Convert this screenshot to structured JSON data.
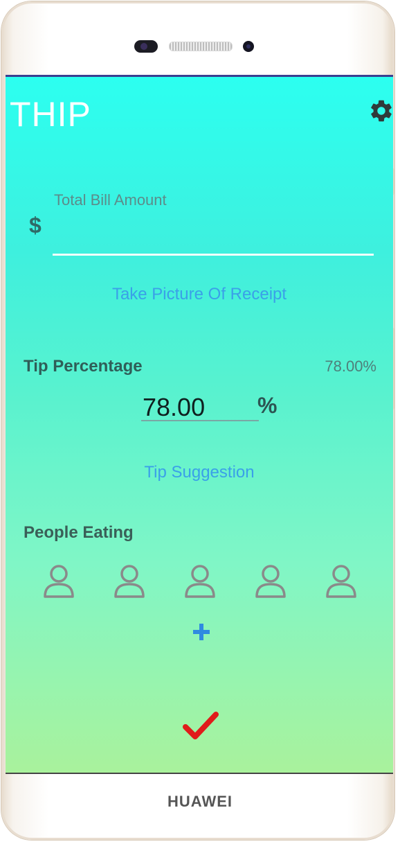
{
  "device": {
    "brand": "HUAWEI"
  },
  "app": {
    "title": "THIP",
    "settings_icon": "gear-icon"
  },
  "bill": {
    "label": "Total Bill Amount",
    "currency": "$",
    "value": "",
    "receipt_button": "Take Picture Of Receipt"
  },
  "tip": {
    "label": "Tip Percentage",
    "display_value": "78.00%",
    "input_value": "78.00",
    "unit": "%",
    "suggestion_button": "Tip Suggestion"
  },
  "people": {
    "label": "People Eating",
    "count": 5,
    "person_icon": "person-icon",
    "add_icon": "plus-icon"
  },
  "confirm": {
    "icon": "checkmark-icon"
  },
  "colors": {
    "accent_blue": "#3aa0e8",
    "confirm_red": "#e01b1b",
    "gradient_top": "#2cfff0",
    "gradient_bottom": "#a9f29c"
  }
}
